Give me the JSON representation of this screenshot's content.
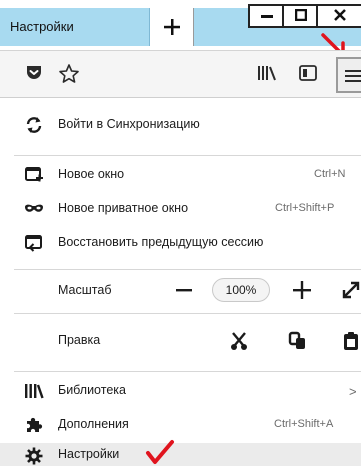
{
  "tab": {
    "title": "Настройки"
  },
  "menu": {
    "sync": {
      "label": "Войти в Синхронизацию"
    },
    "new_window": {
      "label": "Новое окно",
      "shortcut": "Ctrl+N"
    },
    "private_window": {
      "label": "Новое приватное окно",
      "shortcut": "Ctrl+Shift+P"
    },
    "restore_session": {
      "label": "Восстановить предыдущую сессию"
    },
    "zoom": {
      "label": "Масштаб",
      "value": "100%"
    },
    "edit": {
      "label": "Правка"
    },
    "library": {
      "label": "Библиотека",
      "arrow": ">"
    },
    "addons": {
      "label": "Дополнения",
      "shortcut": "Ctrl+Shift+A"
    },
    "settings": {
      "label": "Настройки"
    }
  },
  "colors": {
    "tab_background": "#a8daf0",
    "annotation_red": "#e0141e",
    "highlight_row": "#ebebeb"
  },
  "icons": {
    "toolbar": [
      "pocket-icon",
      "bookmark-star-icon",
      "library-icon",
      "sidebar-icon",
      "hamburger-menu-icon"
    ],
    "menu": [
      "sync-icon",
      "new-window-icon",
      "private-mask-icon",
      "restore-session-icon",
      "cut-icon",
      "copy-icon",
      "paste-icon",
      "library-icon",
      "puzzle-icon",
      "gear-icon"
    ]
  }
}
